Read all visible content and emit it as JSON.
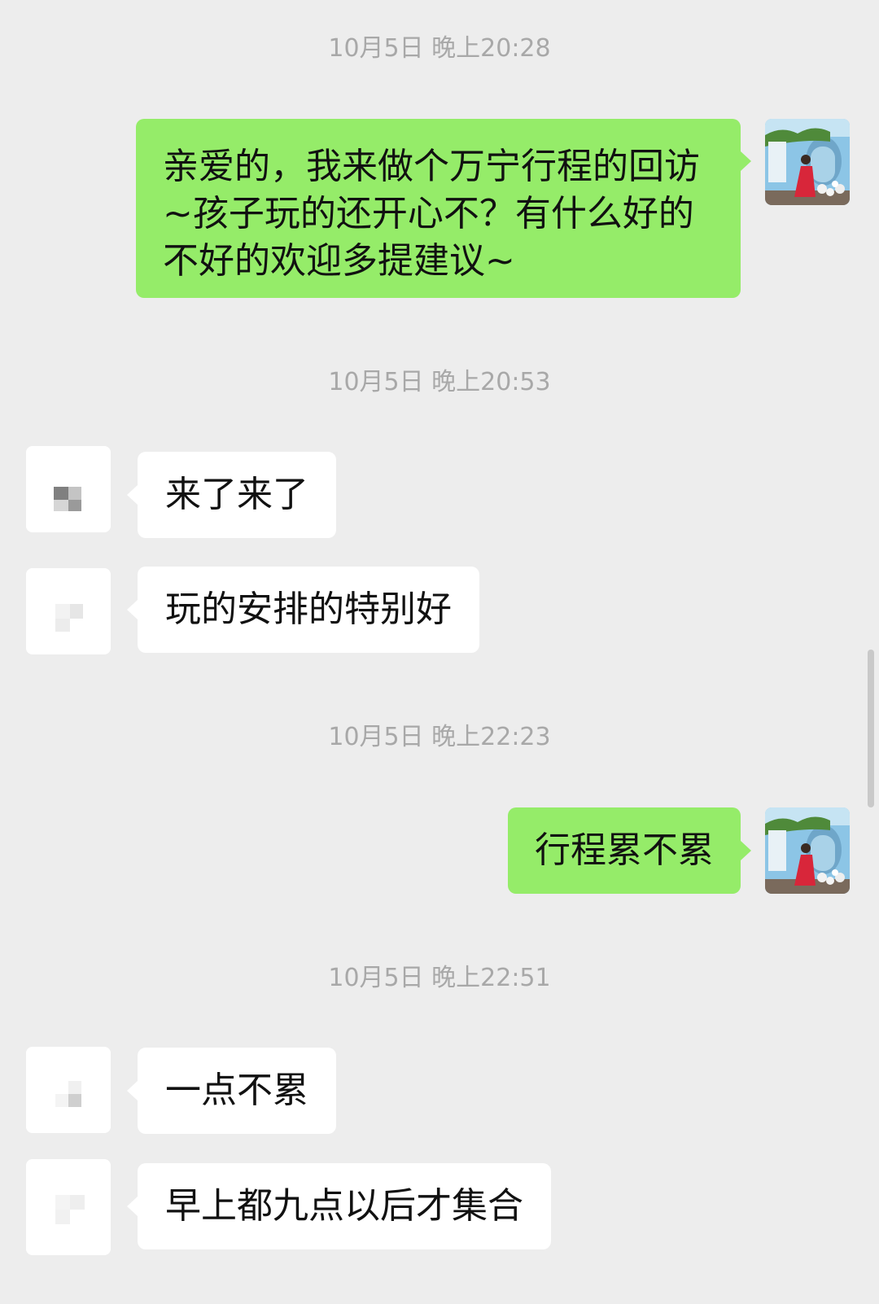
{
  "conversation": {
    "timestamps": [
      "10月5日 晚上20:28",
      "10月5日 晚上20:53",
      "10月5日 晚上22:23",
      "10月5日 晚上22:51"
    ],
    "messages": [
      {
        "side": "outgoing",
        "text": "亲爱的，我来做个万宁行程的回访\n~孩子玩的还开心不？有什么好的\n不好的欢迎多提建议~"
      },
      {
        "side": "incoming",
        "text": "来了来了"
      },
      {
        "side": "incoming",
        "text": "玩的安排的特别好"
      },
      {
        "side": "outgoing",
        "text": "行程累不累"
      },
      {
        "side": "incoming",
        "text": "一点不累"
      },
      {
        "side": "incoming",
        "text": "早上都九点以后才集合"
      }
    ]
  },
  "colors": {
    "background": "#ededed",
    "outgoing_bubble": "#95ec69",
    "incoming_bubble": "#ffffff",
    "timestamp_text": "#a8a8a8"
  },
  "icons": [
    "self-avatar-photo",
    "contact-avatar-pixelated"
  ]
}
